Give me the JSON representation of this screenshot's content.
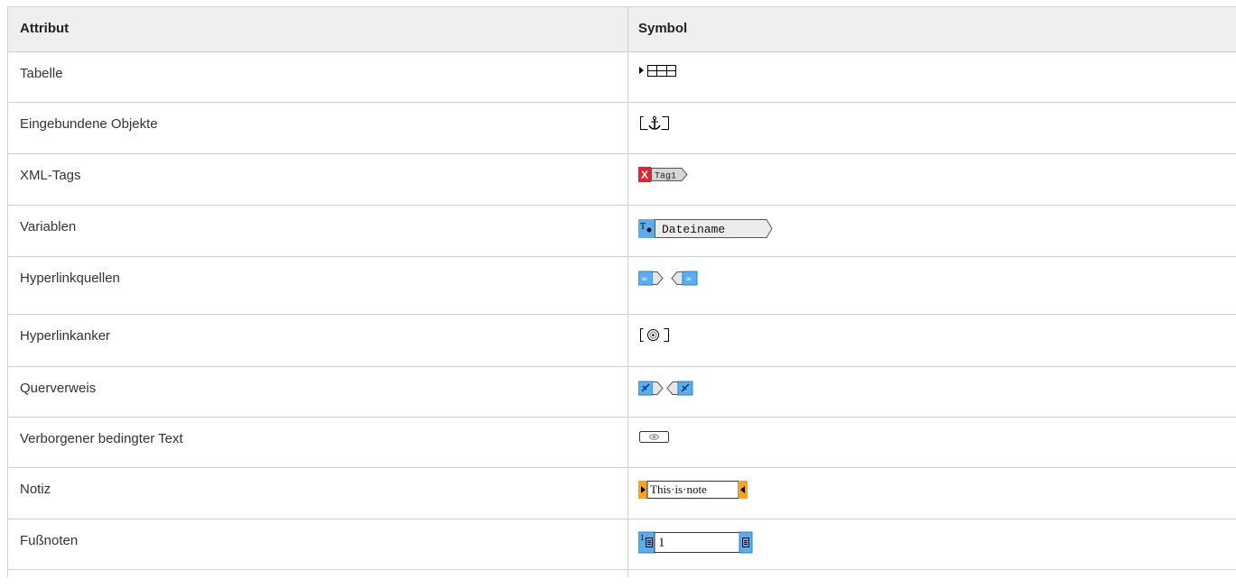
{
  "table": {
    "headers": {
      "attribute": "Attribut",
      "symbol": "Symbol"
    },
    "rows": [
      {
        "label": "Tabelle",
        "icon": "table-icon"
      },
      {
        "label": "Eingebundene Objekte",
        "icon": "anchored-object-icon"
      },
      {
        "label": "XML-Tags",
        "icon": "xml-tag-icon",
        "icon_text": "Tag1"
      },
      {
        "label": "Variablen",
        "icon": "text-variable-icon",
        "icon_text": "Dateiname"
      },
      {
        "label": "Hyperlinkquellen",
        "icon": "hyperlink-source-icon"
      },
      {
        "label": "Hyperlinkanker",
        "icon": "hyperlink-anchor-icon"
      },
      {
        "label": "Querverweis",
        "icon": "cross-reference-icon"
      },
      {
        "label": "Verborgener bedingter Text",
        "icon": "hidden-conditional-text-icon"
      },
      {
        "label": "Notiz",
        "icon": "note-icon",
        "icon_text": "This·is·note"
      },
      {
        "label": "Fußnoten",
        "icon": "footnote-icon",
        "icon_text": "1"
      }
    ]
  },
  "colors": {
    "border": "#cfcfcf",
    "header_bg": "#efefef",
    "tag_red": "#e0252f",
    "blue": "#5aaef0",
    "orange": "#f7a325"
  }
}
